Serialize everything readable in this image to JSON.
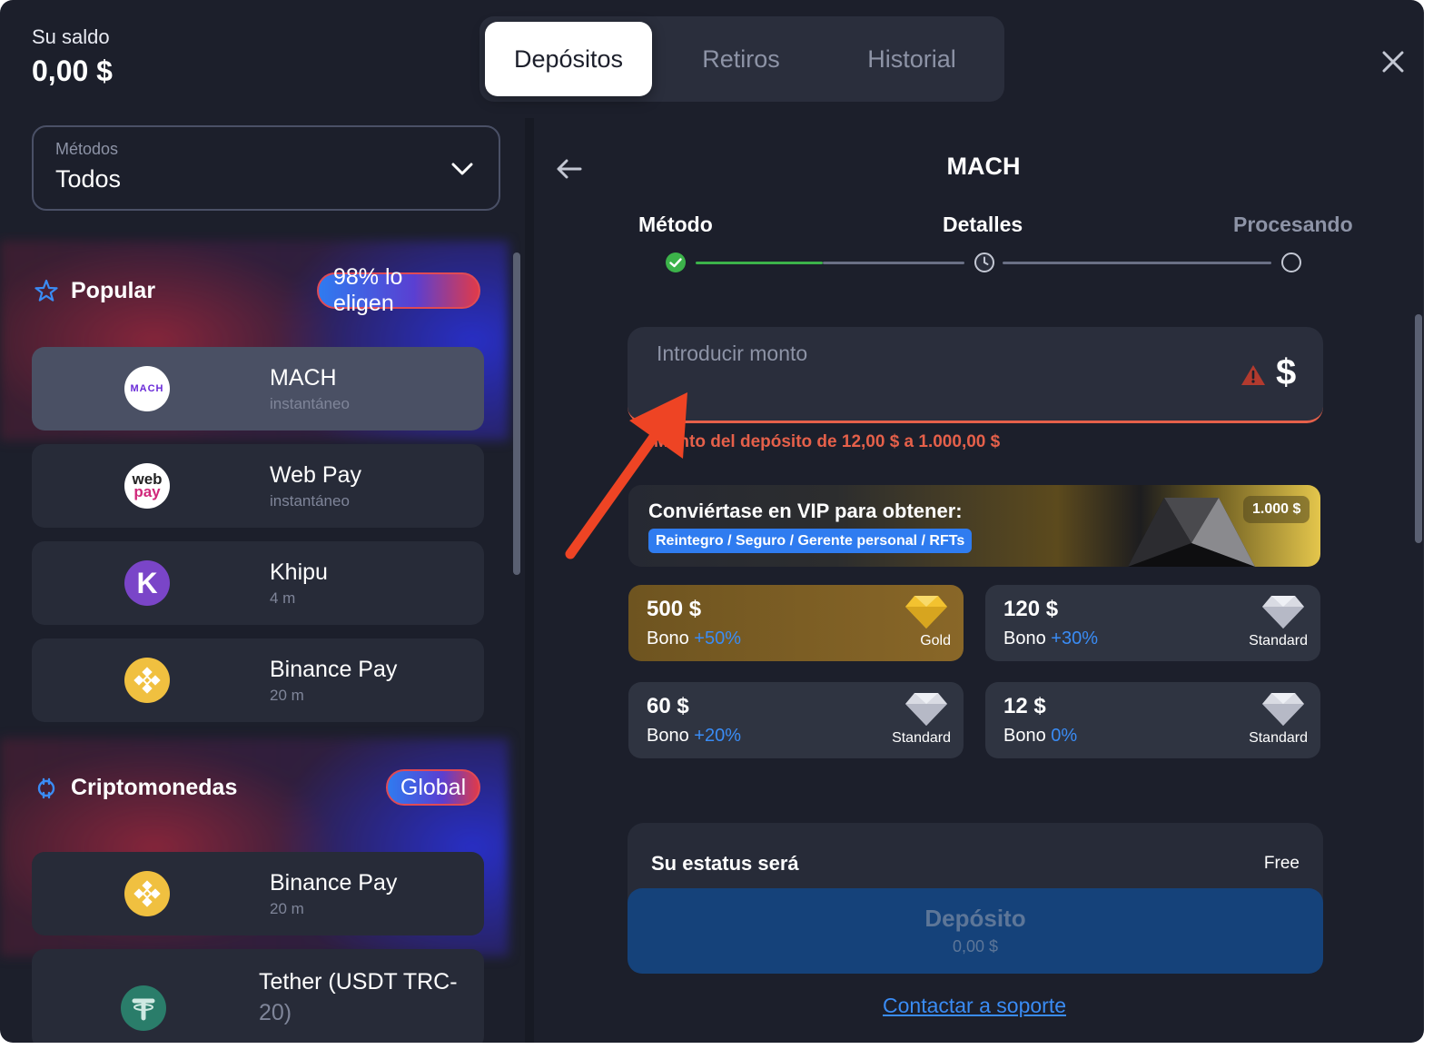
{
  "balance": {
    "label": "Su saldo",
    "value": "0,00 $"
  },
  "tabs": [
    {
      "label": "Depósitos",
      "active": true
    },
    {
      "label": "Retiros",
      "active": false
    },
    {
      "label": "Historial",
      "active": false
    }
  ],
  "methods_select": {
    "label": "Métodos",
    "value": "Todos"
  },
  "sections": {
    "popular": {
      "title": "Popular",
      "badge": "98% lo eligen",
      "items": [
        {
          "name": "MACH",
          "sub": "instantáneo",
          "logo": "mach-logo",
          "selected": true
        },
        {
          "name": "Web Pay",
          "sub": "instantáneo",
          "logo": "webpay-logo",
          "selected": false
        },
        {
          "name": "Khipu",
          "sub": "4 m",
          "logo": "khipu-logo",
          "selected": false
        },
        {
          "name": "Binance Pay",
          "sub": "20 m",
          "logo": "binance-logo",
          "selected": false
        }
      ]
    },
    "crypto": {
      "title": "Criptomonedas",
      "badge": "Global",
      "items": [
        {
          "name": "Binance Pay",
          "sub": "20 m",
          "logo": "binance-logo"
        },
        {
          "name": "Tether (USDT TRC-",
          "name2": "20)",
          "logo": "tether-logo"
        }
      ]
    }
  },
  "detail": {
    "title": "MACH",
    "steps": [
      {
        "label": "Método",
        "state": "done"
      },
      {
        "label": "Detalles",
        "state": "current"
      },
      {
        "label": "Procesando",
        "state": "pending"
      }
    ],
    "amount": {
      "placeholder": "Introducir monto",
      "currency": "$",
      "error": "Monto del depósito de 12,00 $ a 1.000,00 $"
    },
    "vip": {
      "title": "Conviértase en VIP para obtener:",
      "perks": "Reintegro / Seguro / Gerente personal / RFTs",
      "amount": "1.000 $"
    },
    "presets": [
      {
        "amount": "500 $",
        "bono_label": "Bono",
        "bono": "+50%",
        "tier": "Gold"
      },
      {
        "amount": "120 $",
        "bono_label": "Bono",
        "bono": "+30%",
        "tier": "Standard"
      },
      {
        "amount": "60 $",
        "bono_label": "Bono",
        "bono": "+20%",
        "tier": "Standard"
      },
      {
        "amount": "12 $",
        "bono_label": "Bono",
        "bono": "0%",
        "tier": "Standard"
      }
    ],
    "status": {
      "label": "Su estatus será",
      "value": "Free"
    },
    "deposit_button": {
      "label": "Depósito",
      "amount": "0,00 $"
    },
    "support_link": "Contactar a soporte"
  },
  "colors": {
    "background": "#1c1f2b",
    "accent_blue": "#3a8cf5",
    "error": "#e5604a",
    "step_done": "#3cb34a",
    "annotation_arrow": "#ee4424"
  }
}
